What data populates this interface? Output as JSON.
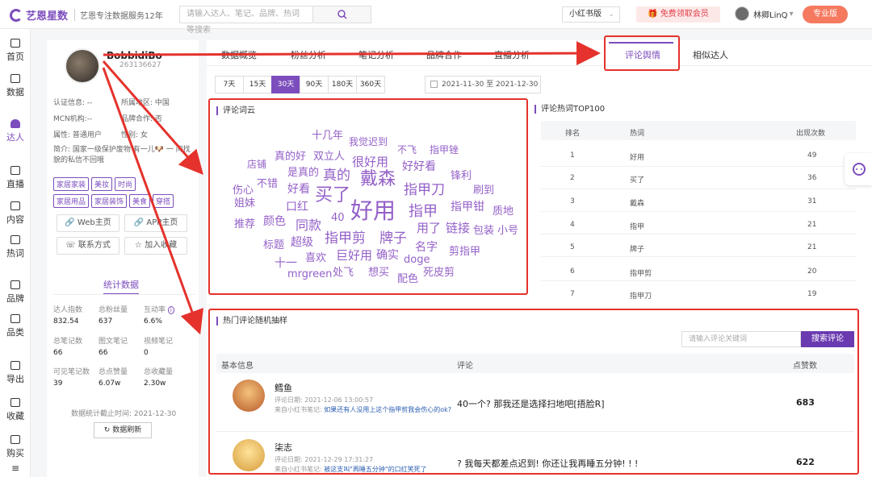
{
  "header": {
    "logo": "艺恩星数",
    "slogan": "艺恩专注数据服务12年",
    "search_placeholder": "请输入达人、笔记、品牌、热词等搜索",
    "version": "小红书版",
    "vip_label": "免费领取会员",
    "user_name": "林卿LinQ",
    "pro_label": "专业版"
  },
  "nav": [
    {
      "label": "首页"
    },
    {
      "label": "数据"
    },
    {
      "label": "达人"
    },
    {
      "label": "直播"
    },
    {
      "label": "内容"
    },
    {
      "label": "热词"
    },
    {
      "label": "品牌"
    },
    {
      "label": "品类"
    },
    {
      "label": "导出"
    },
    {
      "label": "收藏"
    },
    {
      "label": "购买"
    }
  ],
  "profile": {
    "name": "BobbidiBo",
    "id": "263136627",
    "cert_label": "认证信息: --",
    "region_label": "所属地区: 中国",
    "mcn_label": "MCN机构:--",
    "brand_coop_label": "品牌合作: 否",
    "attr_label": "属性: 普通用户",
    "gender_label": "性别: 女",
    "intro": "简介: 国家一级保护废物 有一儿🐶 一 问找貌的私信不回哦",
    "tags": [
      "家居家装",
      "美妆",
      "时尚",
      "家居用品",
      "家居装饰",
      "美食",
      "穿搭"
    ],
    "web_btn": "Web主页",
    "app_btn": "APP主页",
    "contact_btn": "联系方式",
    "fav_btn": "加入收藏",
    "stats_title": "统计数据",
    "stats": [
      {
        "label": "达人指数",
        "value": "832.54"
      },
      {
        "label": "总粉丝量",
        "value": "637"
      },
      {
        "label": "互动率",
        "value": "6.6%"
      },
      {
        "label": "总笔记数",
        "value": "66"
      },
      {
        "label": "图文笔记",
        "value": "66"
      },
      {
        "label": "视频笔记",
        "value": "0"
      },
      {
        "label": "可见笔记数",
        "value": "39"
      },
      {
        "label": "总点赞量",
        "value": "6.07w"
      },
      {
        "label": "总收藏量",
        "value": "2.30w"
      }
    ],
    "date_label": "数据统计截止时间: 2021-12-30",
    "refresh_btn": "数据刷新"
  },
  "tabs": [
    "数据概览",
    "粉丝分析",
    "笔记分析",
    "品牌合作",
    "直播分析",
    "评论舆情",
    "相似达人"
  ],
  "active_tab": "评论舆情",
  "day_filters": [
    "7天",
    "15天",
    "30天",
    "90天",
    "180天",
    "360天"
  ],
  "active_day": "30天",
  "date_range": "2021-11-30  至  2021-12-30",
  "cloud": {
    "title": "评论词云",
    "words": [
      "十几年",
      "我觉迟到",
      "不飞",
      "指甲锉",
      "店铺",
      "真的好",
      "双立人",
      "很好用",
      "好好看",
      "伤心",
      "不错",
      "是真的",
      "真的",
      "戴森",
      "锋利",
      "姐妹",
      "好看",
      "买了",
      "指甲刀",
      "刷到",
      "口红",
      "好用",
      "指甲钳",
      "质地",
      "推荐",
      "颜色",
      "同款",
      "40",
      "指甲",
      "用了",
      "链接",
      "包装",
      "小号",
      "标题",
      "超级",
      "指甲剪",
      "牌子",
      "名字",
      "剪指甲",
      "十一",
      "喜欢",
      "巨好用",
      "确实",
      "doge",
      "mrgreen",
      "处飞",
      "想买",
      "配色",
      "死皮剪"
    ]
  },
  "hot": {
    "title": "评论热词TOP100",
    "headers": [
      "排名",
      "热词",
      "出现次数"
    ],
    "rows": [
      {
        "rank": "1",
        "word": "好用",
        "count": "49"
      },
      {
        "rank": "2",
        "word": "买了",
        "count": "36"
      },
      {
        "rank": "3",
        "word": "戴森",
        "count": "31"
      },
      {
        "rank": "4",
        "word": "指甲",
        "count": "21"
      },
      {
        "rank": "5",
        "word": "牌子",
        "count": "21"
      },
      {
        "rank": "6",
        "word": "指甲剪",
        "count": "20"
      },
      {
        "rank": "7",
        "word": "指甲刀",
        "count": "19"
      }
    ]
  },
  "sample": {
    "title": "热门评论随机抽样",
    "kw_placeholder": "请输入评论关键词",
    "search_btn": "搜索评论",
    "headers": [
      "基本信息",
      "评论",
      "点赞数"
    ],
    "comments": [
      {
        "name": "鳕鱼",
        "date": "评论日期: 2021-12-06 13:00:57",
        "src_prefix": "来自小红书笔记: ",
        "src_link": "如果还有人没用上这个指甲剪我会伤心的ok?",
        "text": "40一个? 那我还是选择扫地吧[捂脸R]",
        "likes": "683"
      },
      {
        "name": "柒志",
        "date": "评论日期: 2021-12-29 17:31:27",
        "src_prefix": "来自小红书笔记: ",
        "src_link": "被这支叫\"再睡五分钟\"的口红笑死了",
        "text": "? 我每天都差点迟到! 你还让我再睡五分钟! ! !",
        "likes": "622"
      }
    ]
  }
}
